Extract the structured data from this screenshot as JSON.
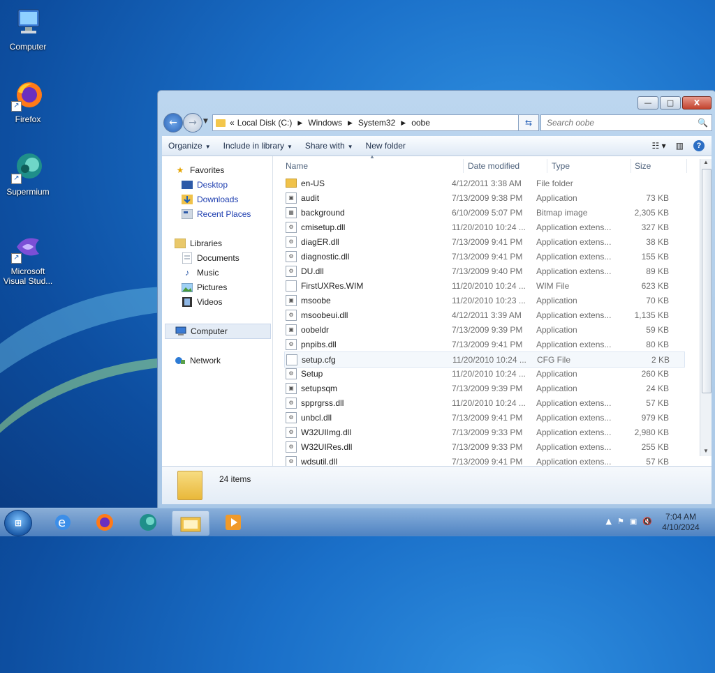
{
  "desktop": {
    "icons": [
      {
        "label": "Computer"
      },
      {
        "label": "Firefox"
      },
      {
        "label": "Supermium"
      },
      {
        "label": "Microsoft Visual Stud..."
      }
    ]
  },
  "window": {
    "controls": {
      "minimize": "—",
      "maximize": "□",
      "close": "X"
    },
    "address": {
      "prefix": "«",
      "crumbs": [
        "Local Disk (C:)",
        "Windows",
        "System32",
        "oobe"
      ]
    },
    "search": {
      "placeholder": "Search oobe"
    },
    "toolbar": {
      "organize": "Organize",
      "include": "Include in library",
      "share": "Share with",
      "new_folder": "New folder",
      "help": "?"
    },
    "nav": {
      "favorites": "Favorites",
      "desktop": "Desktop",
      "downloads": "Downloads",
      "recent": "Recent Places",
      "libraries": "Libraries",
      "documents": "Documents",
      "music": "Music",
      "pictures": "Pictures",
      "videos": "Videos",
      "computer": "Computer",
      "network": "Network"
    },
    "columns": {
      "name": "Name",
      "date": "Date modified",
      "type": "Type",
      "size": "Size"
    },
    "files": [
      {
        "name": "en-US",
        "date": "4/12/2011 3:38 AM",
        "type": "File folder",
        "size": "",
        "icon": "folder-icon"
      },
      {
        "name": "audit",
        "date": "7/13/2009 9:38 PM",
        "type": "Application",
        "size": "73 KB",
        "icon": "app-icon"
      },
      {
        "name": "background",
        "date": "6/10/2009 5:07 PM",
        "type": "Bitmap image",
        "size": "2,305 KB",
        "icon": "image-icon"
      },
      {
        "name": "cmisetup.dll",
        "date": "11/20/2010 10:24 ...",
        "type": "Application extens...",
        "size": "327 KB",
        "icon": "dll-icon"
      },
      {
        "name": "diagER.dll",
        "date": "7/13/2009 9:41 PM",
        "type": "Application extens...",
        "size": "38 KB",
        "icon": "dll-icon"
      },
      {
        "name": "diagnostic.dll",
        "date": "7/13/2009 9:41 PM",
        "type": "Application extens...",
        "size": "155 KB",
        "icon": "dll-icon"
      },
      {
        "name": "DU.dll",
        "date": "7/13/2009 9:40 PM",
        "type": "Application extens...",
        "size": "89 KB",
        "icon": "dll-icon"
      },
      {
        "name": "FirstUXRes.WIM",
        "date": "11/20/2010 10:24 ...",
        "type": "WIM File",
        "size": "623 KB",
        "icon": "file-icon"
      },
      {
        "name": "msoobe",
        "date": "11/20/2010 10:23 ...",
        "type": "Application",
        "size": "70 KB",
        "icon": "app-icon"
      },
      {
        "name": "msoobeui.dll",
        "date": "4/12/2011 3:39 AM",
        "type": "Application extens...",
        "size": "1,135 KB",
        "icon": "dll-icon"
      },
      {
        "name": "oobeldr",
        "date": "7/13/2009 9:39 PM",
        "type": "Application",
        "size": "59 KB",
        "icon": "app-icon"
      },
      {
        "name": "pnpibs.dll",
        "date": "7/13/2009 9:41 PM",
        "type": "Application extens...",
        "size": "80 KB",
        "icon": "dll-icon"
      },
      {
        "name": "setup.cfg",
        "date": "11/20/2010 10:24 ...",
        "type": "CFG File",
        "size": "2 KB",
        "icon": "file-icon"
      },
      {
        "name": "Setup",
        "date": "11/20/2010 10:24 ...",
        "type": "Application",
        "size": "260 KB",
        "icon": "setup-icon"
      },
      {
        "name": "setupsqm",
        "date": "7/13/2009 9:39 PM",
        "type": "Application",
        "size": "24 KB",
        "icon": "app-icon"
      },
      {
        "name": "spprgrss.dll",
        "date": "11/20/2010 10:24 ...",
        "type": "Application extens...",
        "size": "57 KB",
        "icon": "dll-icon"
      },
      {
        "name": "unbcl.dll",
        "date": "7/13/2009 9:41 PM",
        "type": "Application extens...",
        "size": "979 KB",
        "icon": "dll-icon"
      },
      {
        "name": "W32UIImg.dll",
        "date": "7/13/2009 9:33 PM",
        "type": "Application extens...",
        "size": "2,980 KB",
        "icon": "dll-icon"
      },
      {
        "name": "W32UIRes.dll",
        "date": "7/13/2009 9:33 PM",
        "type": "Application extens...",
        "size": "255 KB",
        "icon": "dll-icon"
      },
      {
        "name": "wdsutil.dll",
        "date": "7/13/2009 9:41 PM",
        "type": "Application extens...",
        "size": "57 KB",
        "icon": "dll-icon"
      }
    ],
    "status": {
      "count": "24 items"
    }
  },
  "taskbar": {
    "clock": {
      "time": "7:04 AM",
      "date": "4/10/2024"
    }
  }
}
